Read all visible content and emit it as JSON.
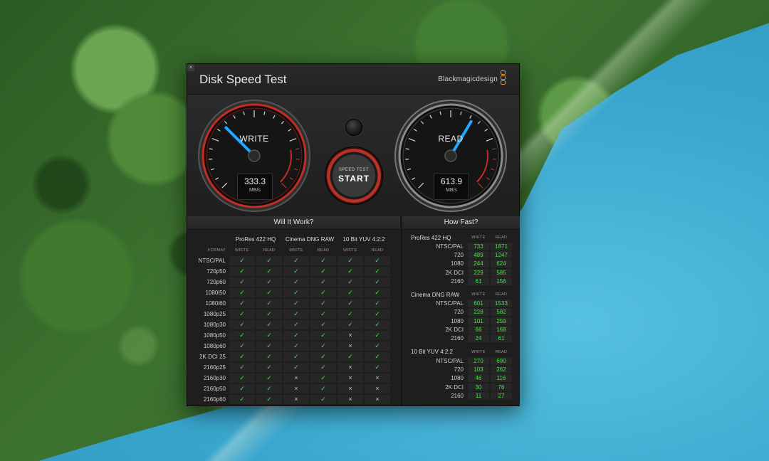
{
  "app": {
    "title": "Disk Speed Test",
    "brand": "Blackmagicdesign",
    "close_glyph": "×",
    "accent": "#e3932a"
  },
  "gauges": {
    "write": {
      "label": "WRITE",
      "value": "333.3",
      "unit": "MB/s",
      "level": 333.3,
      "max": 1000,
      "needle_color": "#1fa9ff"
    },
    "read": {
      "label": "READ",
      "value": "613.9",
      "unit": "MB/s",
      "level": 613.9,
      "max": 1000,
      "needle_color": "#1fa9ff"
    }
  },
  "start_button": {
    "sub": "SPEED TEST",
    "main": "START",
    "ring_color": "#b8322a"
  },
  "will_it_work": {
    "header": "Will It Work?",
    "format_caption": "FORMAT",
    "sub_write": "WRITE",
    "sub_read": "READ",
    "codecs": [
      "ProRes 422 HQ",
      "Cinema DNG RAW",
      "10 Bit YUV 4:2:2"
    ],
    "ok_glyph": "✓",
    "no_glyph": "×",
    "rows": [
      {
        "format": "NTSC/PAL",
        "cells": [
          1,
          1,
          1,
          1,
          1,
          1
        ]
      },
      {
        "format": "720p50",
        "cells": [
          1,
          1,
          1,
          1,
          1,
          1
        ]
      },
      {
        "format": "720p60",
        "cells": [
          1,
          1,
          1,
          1,
          1,
          1
        ]
      },
      {
        "format": "1080i50",
        "cells": [
          1,
          1,
          1,
          1,
          1,
          1
        ]
      },
      {
        "format": "1080i60",
        "cells": [
          1,
          1,
          1,
          1,
          1,
          1
        ]
      },
      {
        "format": "1080p25",
        "cells": [
          1,
          1,
          1,
          1,
          1,
          1
        ]
      },
      {
        "format": "1080p30",
        "cells": [
          1,
          1,
          1,
          1,
          1,
          1
        ]
      },
      {
        "format": "1080p50",
        "cells": [
          1,
          1,
          1,
          1,
          0,
          1
        ]
      },
      {
        "format": "1080p60",
        "cells": [
          1,
          1,
          1,
          1,
          0,
          1
        ]
      },
      {
        "format": "2K DCI 25",
        "cells": [
          1,
          1,
          1,
          1,
          1,
          1
        ]
      },
      {
        "format": "2160p25",
        "cells": [
          1,
          1,
          1,
          1,
          0,
          1
        ]
      },
      {
        "format": "2160p30",
        "cells": [
          1,
          1,
          0,
          1,
          0,
          0
        ]
      },
      {
        "format": "2160p50",
        "cells": [
          1,
          1,
          0,
          1,
          0,
          0
        ]
      },
      {
        "format": "2160p60",
        "cells": [
          1,
          1,
          0,
          1,
          0,
          0
        ]
      }
    ]
  },
  "how_fast": {
    "header": "How Fast?",
    "sub_write": "WRITE",
    "sub_read": "READ",
    "groups": [
      {
        "title": "ProRes 422 HQ",
        "rows": [
          {
            "format": "NTSC/PAL",
            "write": "733",
            "read": "1871"
          },
          {
            "format": "720",
            "write": "489",
            "read": "1247"
          },
          {
            "format": "1080",
            "write": "244",
            "read": "624"
          },
          {
            "format": "2K DCI",
            "write": "229",
            "read": "585"
          },
          {
            "format": "2160",
            "write": "61",
            "read": "156"
          }
        ]
      },
      {
        "title": "Cinema DNG RAW",
        "rows": [
          {
            "format": "NTSC/PAL",
            "write": "601",
            "read": "1533"
          },
          {
            "format": "720",
            "write": "228",
            "read": "582"
          },
          {
            "format": "1080",
            "write": "101",
            "read": "259"
          },
          {
            "format": "2K DCI",
            "write": "66",
            "read": "168"
          },
          {
            "format": "2160",
            "write": "24",
            "read": "61"
          }
        ]
      },
      {
        "title": "10 Bit YUV 4:2:2",
        "rows": [
          {
            "format": "NTSC/PAL",
            "write": "270",
            "read": "690"
          },
          {
            "format": "720",
            "write": "103",
            "read": "262"
          },
          {
            "format": "1080",
            "write": "46",
            "read": "116"
          },
          {
            "format": "2K DCI",
            "write": "30",
            "read": "76"
          },
          {
            "format": "2160",
            "write": "11",
            "read": "27"
          }
        ]
      }
    ]
  }
}
